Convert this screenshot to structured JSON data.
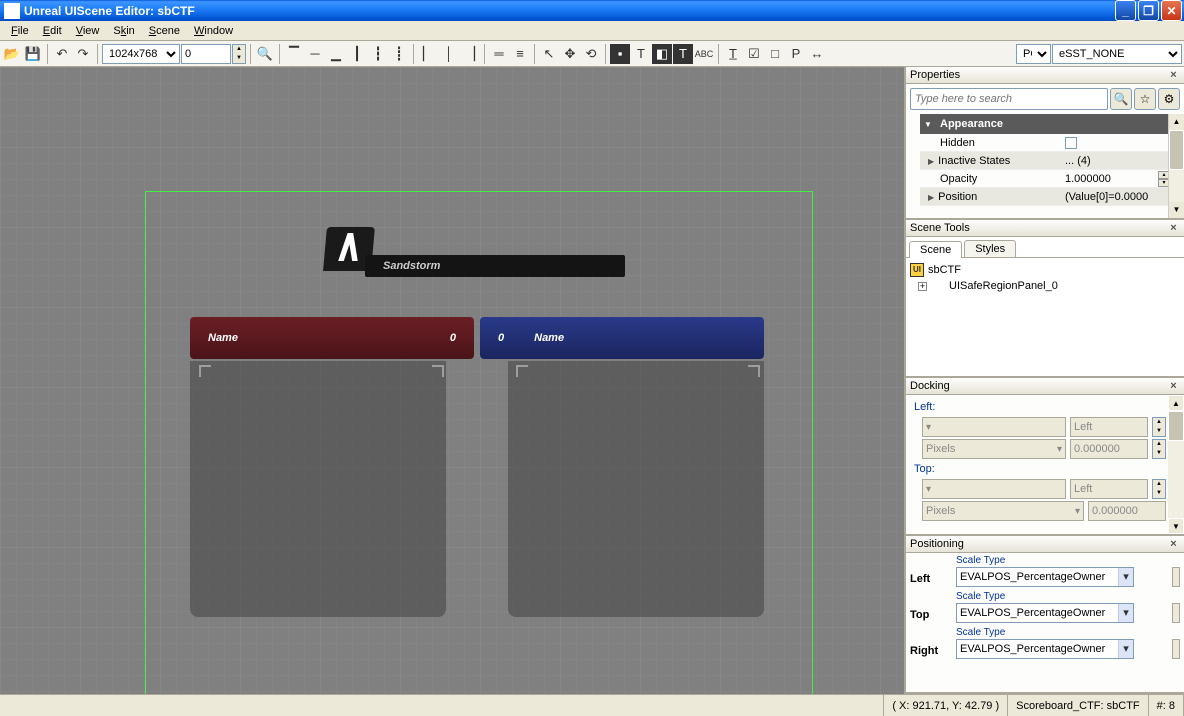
{
  "titlebar": {
    "text": "Unreal UIScene Editor: sbCTF"
  },
  "menu": {
    "file": "File",
    "edit": "Edit",
    "view": "View",
    "skin": "Skin",
    "scene": "Scene",
    "window": "Window"
  },
  "toolbar": {
    "resolution": "1024x768",
    "zoom_value": "0",
    "platform": "PC",
    "split": "eSST_NONE"
  },
  "scene": {
    "map_name": "Sandstorm",
    "red": {
      "name_label": "Name",
      "score": "0"
    },
    "blue": {
      "name_label": "Name",
      "score": "0"
    }
  },
  "properties": {
    "title": "Properties",
    "search_placeholder": "Type here to search",
    "category": "Appearance",
    "rows": {
      "hidden": {
        "label": "Hidden"
      },
      "inactive": {
        "label": "Inactive States",
        "value": "... (4)"
      },
      "opacity": {
        "label": "Opacity",
        "value": "1.000000"
      },
      "position": {
        "label": "Position",
        "value": "(Value[0]=0.0000"
      }
    }
  },
  "scenetools": {
    "title": "Scene Tools",
    "tab_scene": "Scene",
    "tab_styles": "Styles",
    "root": "sbCTF",
    "child": "UISafeRegionPanel_0"
  },
  "docking": {
    "title": "Docking",
    "left_label": "Left:",
    "top_label": "Top:",
    "unit": "Pixels",
    "face": "Left",
    "face2": "Left",
    "value": "0.000000",
    "value2": "0.000000"
  },
  "positioning": {
    "title": "Positioning",
    "scale_type": "Scale Type",
    "left": "Left",
    "top": "Top",
    "right": "Right",
    "evalpos": "EVALPOS_PercentageOwner"
  },
  "statusbar": {
    "coords": "( X: 921.71, Y: 42.79 )",
    "scene": "Scoreboard_CTF: sbCTF",
    "extra": "#: 8"
  }
}
